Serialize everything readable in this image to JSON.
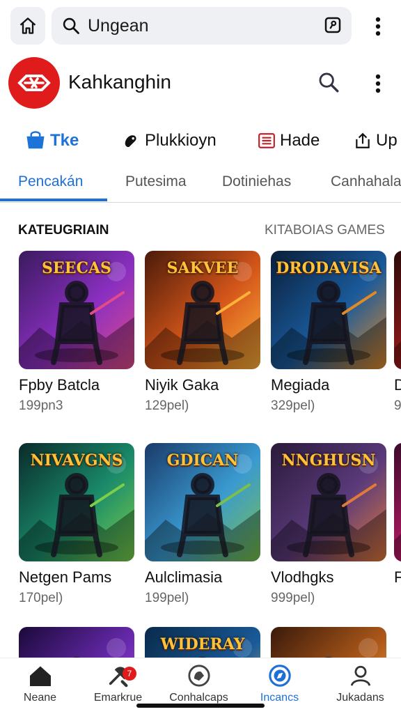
{
  "browser": {
    "url_text": "Ungean",
    "icons": [
      "home-icon",
      "search-icon",
      "tabs-icon",
      "more-vert-icon"
    ]
  },
  "app": {
    "title": "Kahkanghin",
    "icons": [
      "logo-icon",
      "search-icon",
      "more-vert-icon"
    ]
  },
  "chips": [
    {
      "label": "Tke",
      "icon": "store-icon",
      "active": true
    },
    {
      "label": "Plukkioyn",
      "icon": "controller-icon",
      "active": false
    },
    {
      "label": "Hade",
      "icon": "list-icon",
      "active": false
    },
    {
      "label": "Up",
      "icon": "upload-icon",
      "active": false
    }
  ],
  "subtabs": [
    {
      "label": "Pencakán",
      "active": true
    },
    {
      "label": "Putesima",
      "active": false
    },
    {
      "label": "Dotiniehas",
      "active": false
    },
    {
      "label": "Canhahala",
      "active": false
    }
  ],
  "section": {
    "title": "KATEUGRIAIN",
    "link": "KITABOIAS GAMES"
  },
  "games": [
    {
      "name": "Fpby Batcla",
      "size": "199pn3",
      "art_title": "SEECAS",
      "palette": [
        "#3a1a5e",
        "#8a2fc0",
        "#e14b8a"
      ]
    },
    {
      "name": "Niyik Gaka",
      "size": "129pel)",
      "art_title": "SAKVEE",
      "palette": [
        "#4a1a0a",
        "#d4561a",
        "#ffb23a"
      ]
    },
    {
      "name": "Megiada",
      "size": "329pel)",
      "art_title": "DRODAVISA",
      "palette": [
        "#0a1e3a",
        "#1a5a9a",
        "#e08a2a"
      ]
    },
    {
      "name": "D",
      "size": "9",
      "art_title": "",
      "palette": [
        "#2a0a0a",
        "#a01a1a",
        "#ff8a2a"
      ]
    },
    {
      "name": "Netgen Pams",
      "size": "170pel)",
      "art_title": "NIVAVGNS",
      "palette": [
        "#0a2a2a",
        "#1a8a6a",
        "#7ad04a"
      ]
    },
    {
      "name": "Aulclimasia",
      "size": "199pel)",
      "art_title": "GDICAN",
      "palette": [
        "#1a3a6a",
        "#3a9ad0",
        "#7ac04a"
      ]
    },
    {
      "name": "Vlodhgks",
      "size": "999pel)",
      "art_title": "NNGHUSN",
      "palette": [
        "#2a1a3a",
        "#5a3a7a",
        "#e07a3a"
      ]
    },
    {
      "name": "F",
      "size": "",
      "art_title": "",
      "palette": [
        "#3a0a2a",
        "#c01a6a",
        "#ff6a2a"
      ]
    },
    {
      "name": "",
      "size": "",
      "art_title": "",
      "palette": [
        "#1a0a3a",
        "#6a2ab0",
        "#c05ae0"
      ]
    },
    {
      "name": "",
      "size": "",
      "art_title": "WIDERAY",
      "palette": [
        "#0a2a4a",
        "#1a5a9a",
        "#ffc23a"
      ]
    },
    {
      "name": "",
      "size": "",
      "art_title": "",
      "palette": [
        "#3a1a0a",
        "#b05a1a",
        "#ffcc66"
      ]
    }
  ],
  "bottom_nav": [
    {
      "label": "Neane",
      "icon": "home-icon",
      "active": false,
      "badge": ""
    },
    {
      "label": "Emarkrue",
      "icon": "tools-icon",
      "active": false,
      "badge": "7"
    },
    {
      "label": "Conhalcaps",
      "icon": "gamepad-circle-icon",
      "active": false,
      "badge": ""
    },
    {
      "label": "Incancs",
      "icon": "compass-icon",
      "active": true,
      "badge": ""
    },
    {
      "label": "Jukadans",
      "icon": "person-icon",
      "active": false,
      "badge": ""
    }
  ],
  "colors": {
    "accent": "#1e6fd6",
    "logo": "#e01b1b",
    "badge": "#e01b1b"
  }
}
